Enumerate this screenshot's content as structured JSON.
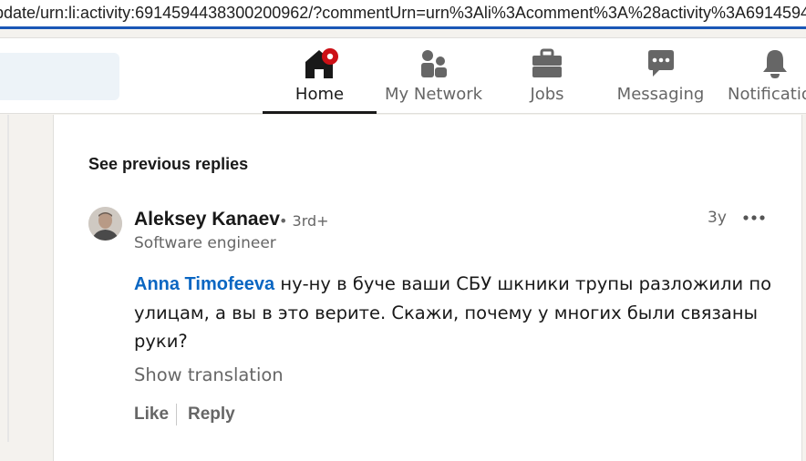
{
  "browser": {
    "url": "pdate/urn:li:activity:6914594438300200962/?commentUrn=urn%3Ali%3Acomment%3A%28activity%3A6914594438"
  },
  "nav": {
    "items": [
      {
        "label": "Home",
        "icon": "home-icon",
        "active": true
      },
      {
        "label": "My Network",
        "icon": "people-icon",
        "active": false
      },
      {
        "label": "Jobs",
        "icon": "briefcase-icon",
        "active": false
      },
      {
        "label": "Messaging",
        "icon": "chat-bubble-icon",
        "active": false
      },
      {
        "label": "Notifications",
        "icon": "bell-icon",
        "active": false
      }
    ],
    "accent": "#cc1016"
  },
  "thread": {
    "see_previous": "See previous replies"
  },
  "comment": {
    "author": "Aleksey Kanaev",
    "degree": "• 3rd+",
    "headline": "Software engineer",
    "time": "3y",
    "mention": "Anna Timofeeva",
    "text": " ну-ну в буче ваши СБУ шкники трупы разложили по улицам, а вы в это верите. Скажи, почему у многих были связаны руки?",
    "show_translation": "Show translation",
    "actions": {
      "like": "Like",
      "reply": "Reply"
    }
  },
  "colors": {
    "link": "#0a66c2",
    "text": "#191919",
    "muted": "#666666"
  }
}
